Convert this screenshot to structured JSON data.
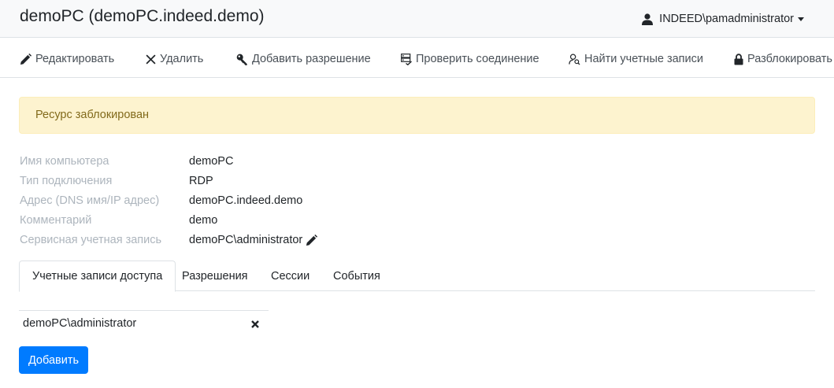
{
  "header": {
    "title": "demoPC (demoPC.indeed.demo)",
    "user": "INDEED\\pamadministrator"
  },
  "toolbar": {
    "edit": "Редактировать",
    "delete": "Удалить",
    "add_permission": "Добавить разрешение",
    "check_connection": "Проверить соединение",
    "find_accounts": "Найти учетные записи",
    "unlock": "Разблокировать"
  },
  "alert": {
    "text": "Ресурс заблокирован"
  },
  "properties": [
    {
      "label": "Имя компьютера",
      "value": "demoPC"
    },
    {
      "label": "Тип подключения",
      "value": "RDP"
    },
    {
      "label": "Адрес (DNS имя/IP адрес)",
      "value": "demoPC.indeed.demo"
    },
    {
      "label": "Комментарий",
      "value": "demo"
    },
    {
      "label": "Сервисная учетная запись",
      "value": "demoPC\\administrator"
    }
  ],
  "tabs": [
    {
      "label": "Учетные записи доступа",
      "active": true
    },
    {
      "label": "Разрешения",
      "active": false
    },
    {
      "label": "Сессии",
      "active": false
    },
    {
      "label": "События",
      "active": false
    }
  ],
  "accounts": [
    {
      "name": "demoPC\\administrator"
    }
  ],
  "add_button": "Добавить",
  "colors": {
    "primary": "#007bff",
    "alert_bg": "#fdf3cf",
    "alert_text": "#826a1b",
    "label_gray": "#adb5bd"
  }
}
